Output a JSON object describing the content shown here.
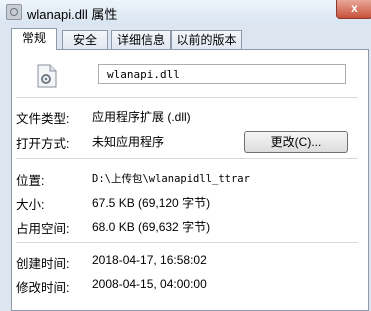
{
  "window": {
    "title": "wlanapi.dll 属性",
    "close_label": "x"
  },
  "tabs": [
    {
      "label": "常规"
    },
    {
      "label": "安全"
    },
    {
      "label": "详细信息"
    },
    {
      "label": "以前的版本"
    }
  ],
  "general": {
    "filename": "wlanapi.dll",
    "file_type_label": "文件类型:",
    "file_type_value": "应用程序扩展 (.dll)",
    "opens_with_label": "打开方式:",
    "opens_with_value": "未知应用程序",
    "change_button": "更改(C)...",
    "location_label": "位置:",
    "location_value": "D:\\上传包\\wlanapidll_ttrar",
    "size_label": "大小:",
    "size_value": "67.5 KB (69,120 字节)",
    "size_on_disk_label": "占用空间:",
    "size_on_disk_value": "68.0 KB (69,632 字节)",
    "created_label": "创建时间:",
    "created_value": "2018-04-17, 16:58:02",
    "modified_label": "修改时间:",
    "modified_value": "2008-04-15, 04:00:00"
  }
}
